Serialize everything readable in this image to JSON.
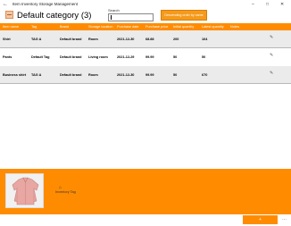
{
  "window": {
    "title": "Item Inventory Storage Management",
    "back_glyph": "←",
    "min_glyph": "–",
    "max_glyph": "□",
    "close_glyph": "✕"
  },
  "header": {
    "title": "Default category (3)",
    "icon": "box-icon",
    "search_label": "Search",
    "search_value": "",
    "sort_button": "Descending order by name"
  },
  "table": {
    "columns": [
      "Item name",
      "Tag",
      "Brand",
      "Storage location",
      "Purchase date",
      "Purchase price",
      "Initial quantity",
      "Latest quantity",
      "Notes"
    ],
    "rows": [
      [
        "Shirt",
        "TAG A",
        "Default brand",
        "Room",
        "2021-12-30",
        "68.88",
        "200",
        "164",
        ""
      ],
      [
        "Pants",
        "Default Tag",
        "Default brand",
        "Living room",
        "2021-12-29",
        "99.99",
        "50",
        "50",
        ""
      ],
      [
        "Business shirt",
        "TAG A",
        "Default brand",
        "Room",
        "2021-12-30",
        "99.99",
        "50",
        "670",
        ""
      ]
    ],
    "edit_glyph": "✎"
  },
  "detail": {
    "tag_icon": "tag-icon",
    "tag_glyph": "⌂",
    "tag_label": "Inventory Tag"
  },
  "bottom": {
    "add_label": "+",
    "more_label": "⋯"
  },
  "colors": {
    "accent": "#ff8c00",
    "button": "#f59a1b"
  }
}
